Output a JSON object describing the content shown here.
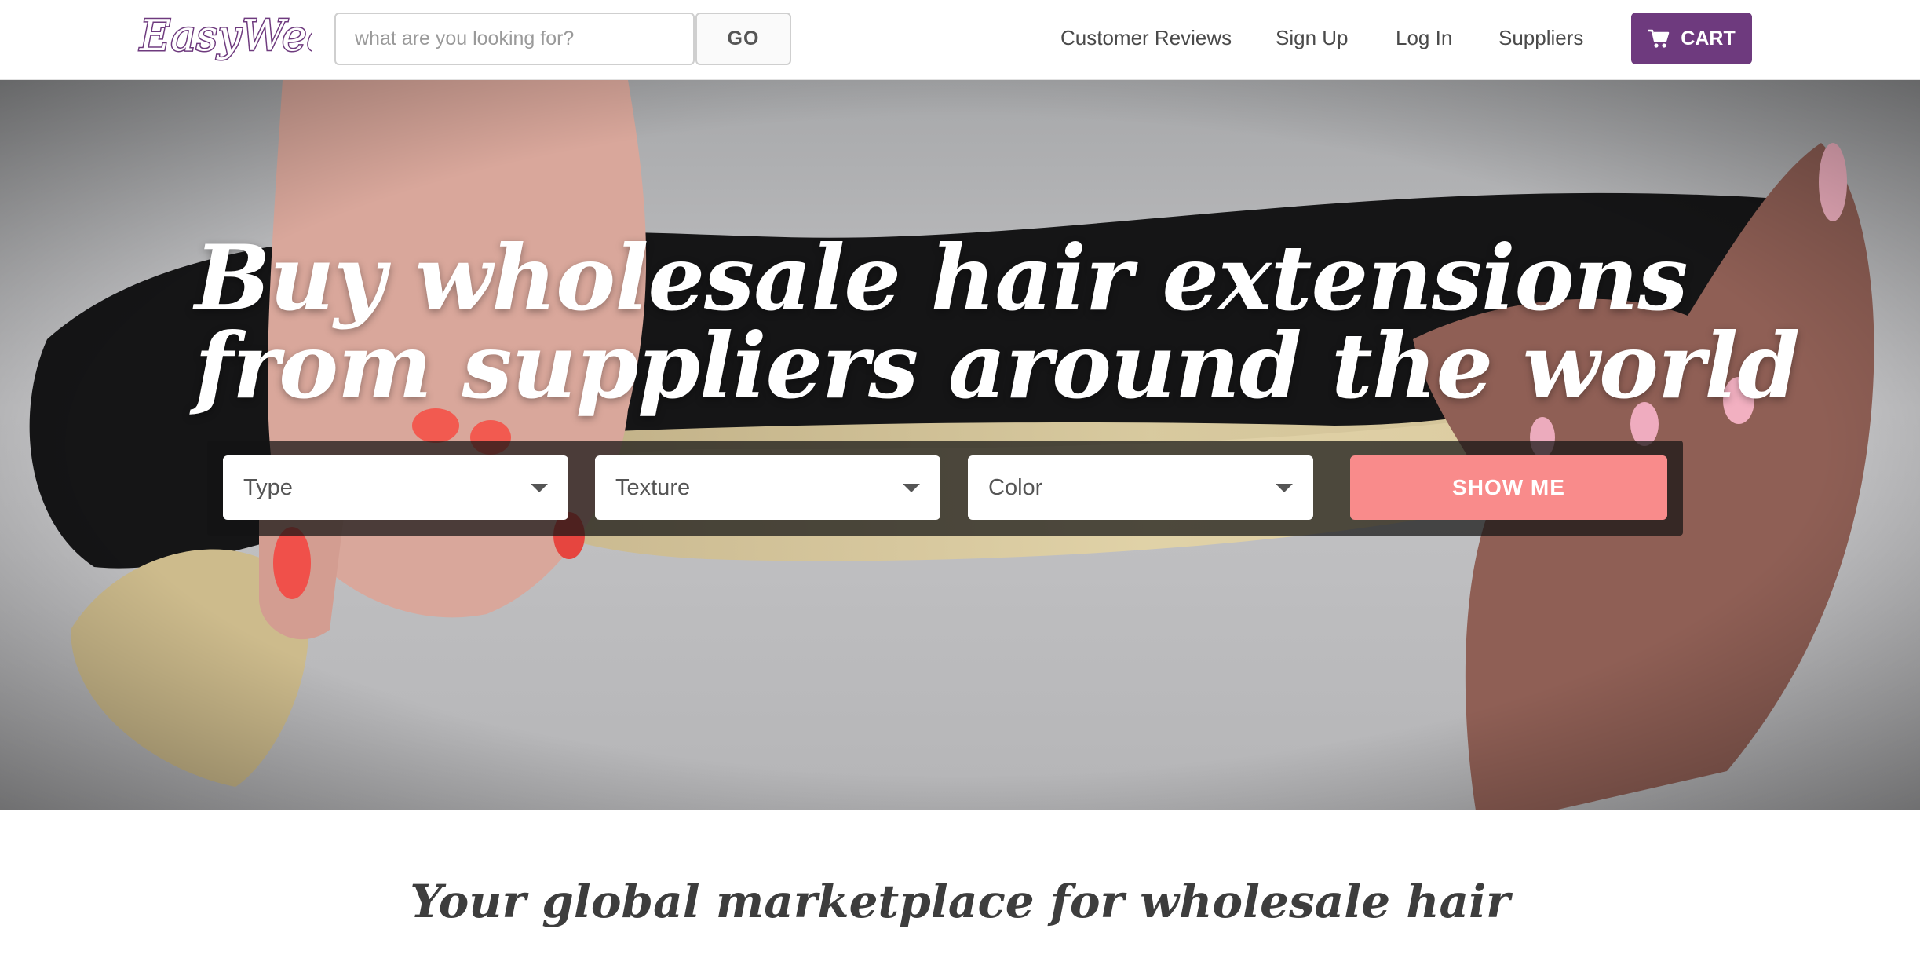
{
  "header": {
    "logo_text": "EasyWeave",
    "search": {
      "placeholder": "what are you looking for?",
      "value": ""
    },
    "go_label": "GO",
    "nav": [
      {
        "label": "Customer Reviews"
      },
      {
        "label": "Sign Up"
      },
      {
        "label": "Log In"
      },
      {
        "label": "Suppliers"
      }
    ],
    "cart_label": "CART",
    "colors": {
      "brand": "#6e3a7e",
      "text": "#4a4a4a"
    }
  },
  "hero": {
    "title_line1": "Buy wholesale hair extensions",
    "title_line2": "from suppliers around the world",
    "filters": [
      {
        "label": "Type",
        "icon": "caret-down-icon"
      },
      {
        "label": "Texture",
        "icon": "caret-down-icon"
      },
      {
        "label": "Color",
        "icon": "caret-down-icon"
      }
    ],
    "show_me_label": "SHOW ME",
    "colors": {
      "accent": "#f98b8b",
      "overlay": "#141414"
    }
  },
  "main": {
    "tagline": "Your global marketplace for wholesale hair"
  }
}
